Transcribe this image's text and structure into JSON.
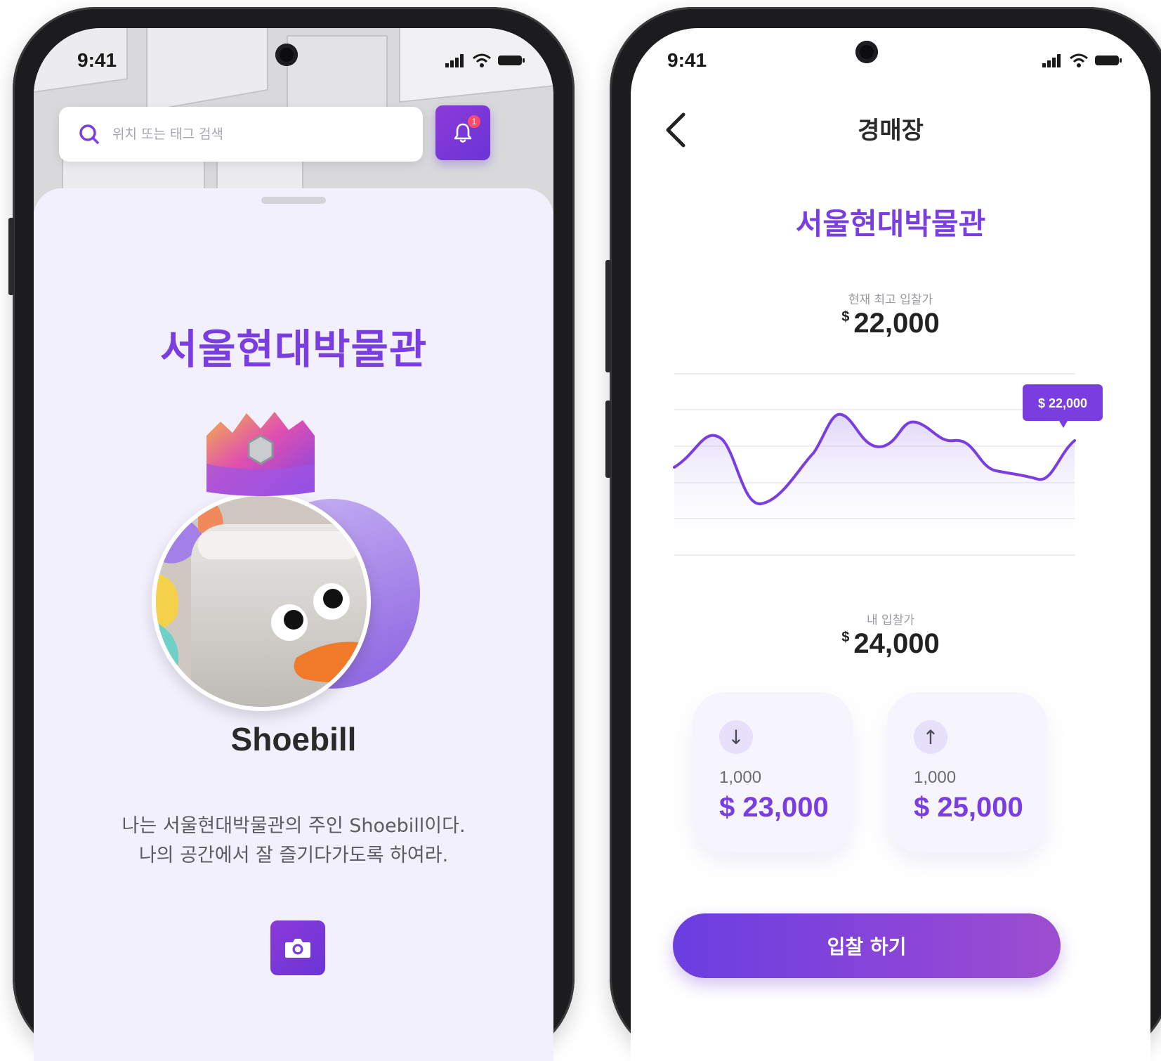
{
  "left_screen": {
    "status_time": "9:41",
    "search": {
      "placeholder": "위치 또는 태그 검색"
    },
    "notification": {
      "badge_count": "1"
    },
    "museum_title": "서울현대박물관",
    "character_name": "Shoebill",
    "description_lines": [
      "나는 서울현대박물관의 주인 Shoebill이다.",
      "나의 공간에서 잘 즐기다가도록 하여라."
    ],
    "icons": {
      "search": "search-icon",
      "notification": "bell-icon",
      "camera": "camera-icon"
    }
  },
  "right_screen": {
    "status_time": "9:41",
    "page_title": "경매장",
    "museum_title": "서울현대박물관",
    "current_bid": {
      "label": "현재 최고 입찰가",
      "currency": "$",
      "amount": "22,000"
    },
    "chart_tooltip": "$ 22,000",
    "my_bid": {
      "label": "내 입찰가",
      "currency": "$",
      "amount": "24,000"
    },
    "decrease_option": {
      "icon": "↓",
      "step": "1,000",
      "price": "$ 23,000"
    },
    "increase_option": {
      "icon": "↑",
      "step": "1,000",
      "price": "$ 25,000"
    },
    "bid_button_label": "입찰 하기",
    "icons": {
      "back": "chevron-left-icon"
    }
  },
  "colors": {
    "accent": "#7a3ee0",
    "accent_dark": "#6a34d6",
    "sheet_bg": "#f3f0fd",
    "badge": "#ff4a6e"
  }
}
